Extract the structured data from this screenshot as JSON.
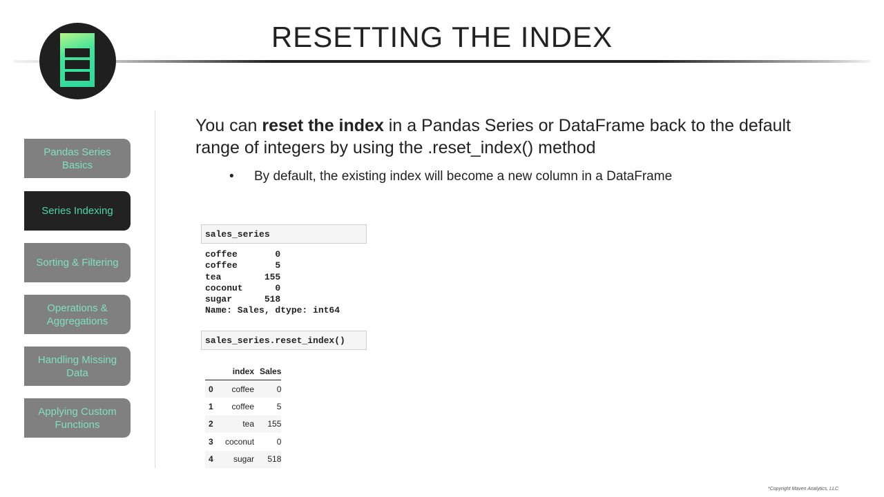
{
  "title": "RESETTING THE INDEX",
  "sidebar": {
    "items": [
      {
        "label": "Pandas Series Basics",
        "active": false
      },
      {
        "label": "Series Indexing",
        "active": true
      },
      {
        "label": "Sorting & Filtering",
        "active": false
      },
      {
        "label": "Operations & Aggregations",
        "active": false
      },
      {
        "label": "Handling Missing Data",
        "active": false
      },
      {
        "label": "Applying Custom Functions",
        "active": false
      }
    ]
  },
  "lead": {
    "pre": "You can ",
    "bold": "reset the index",
    "post": " in a Pandas Series or DataFrame back to the default range of integers by using the .reset_index() method"
  },
  "bullet": "By default, the existing index will become a new column in a DataFrame",
  "cell1": "sales_series",
  "output1": [
    "coffee       0",
    "coffee       5",
    "tea        155",
    "coconut      0",
    "sugar      518",
    "Name: Sales, dtype: int64"
  ],
  "cell2": "sales_series.reset_index()",
  "table": {
    "headers": [
      "",
      "index",
      "Sales"
    ],
    "rows": [
      [
        "0",
        "coffee",
        "0"
      ],
      [
        "1",
        "coffee",
        "5"
      ],
      [
        "2",
        "tea",
        "155"
      ],
      [
        "3",
        "coconut",
        "0"
      ],
      [
        "4",
        "sugar",
        "518"
      ]
    ]
  },
  "copyright": "*Copyright Maven Analytics, LLC",
  "colors": {
    "accent": "#3fe49a",
    "nav_inactive": "#808080",
    "nav_active": "#222222"
  }
}
